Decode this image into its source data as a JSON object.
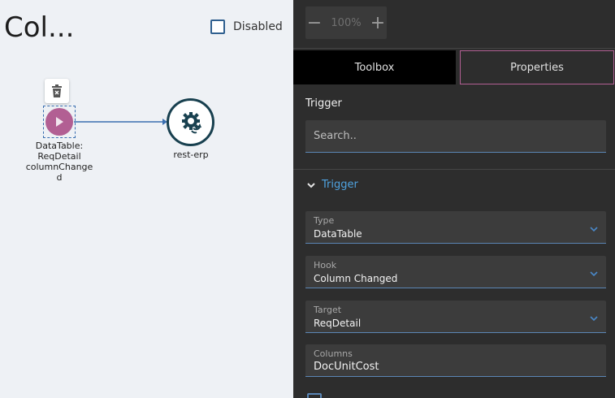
{
  "canvas": {
    "title": "Col...",
    "disabled_label": "Disabled",
    "trigger_node": {
      "label_line1": "DataTable:",
      "label_line2": "ReqDetail",
      "label_line3": "columnChange",
      "label_line4": "d",
      "icon": "play-icon",
      "color": "#b25f93"
    },
    "action_node": {
      "label": "rest-erp",
      "icon": "gear-sync-icon",
      "border_color": "#18404f"
    },
    "connector_color": "#3a6fb0"
  },
  "panel": {
    "zoom": {
      "minus": "−",
      "value": "100%",
      "plus": "+"
    },
    "tabs": {
      "toolbox": "Toolbox",
      "properties": "Properties"
    },
    "section_title": "Trigger",
    "search": {
      "placeholder": "Search.."
    },
    "group": {
      "label": "Trigger"
    },
    "fields": {
      "type": {
        "label": "Type",
        "value": "DataTable"
      },
      "hook": {
        "label": "Hook",
        "value": "Column Changed"
      },
      "target": {
        "label": "Target",
        "value": "ReqDetail"
      },
      "columns": {
        "label": "Columns",
        "value": "DocUnitCost"
      }
    },
    "accent_color": "#4fa3e0",
    "tab_border_color": "#b25f93"
  }
}
